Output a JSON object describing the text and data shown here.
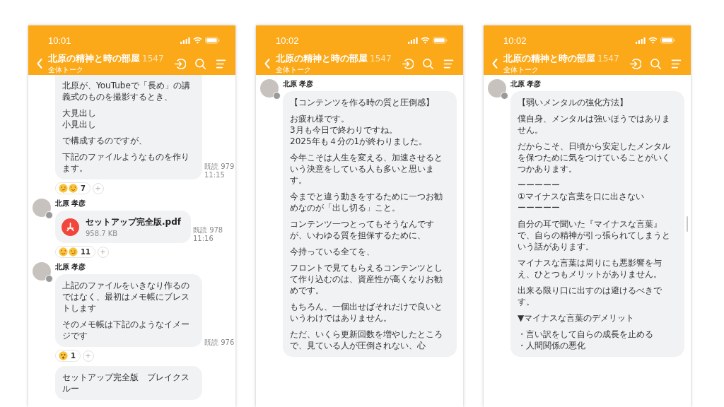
{
  "phones": [
    {
      "status_bar": {
        "time": "10:01"
      },
      "header": {
        "title": "北原の精神と時の部屋",
        "member_count": "1547",
        "subtitle": "全体トーク"
      },
      "messages": [
        {
          "kind": "text",
          "continued": true,
          "paragraphs": [
            [
              "北原が、YouTubeで「長め」の講義式のものを撮影するとき、"
            ],
            [
              "大見出し",
              "小見出し"
            ],
            [
              "で構成するのですが、"
            ],
            [
              "下記のファイルようなものを作ります。"
            ]
          ],
          "read": "既読 979",
          "time": "11:15",
          "reactions": {
            "emojis": [
              {
                "kind": "smirk"
              },
              {
                "kind": "heart_eyes"
              }
            ],
            "count": "7"
          }
        },
        {
          "kind": "file",
          "sender": {
            "name": "北原 孝彦"
          },
          "file_name": "セットアップ完全版.pdf",
          "file_size": "958.7 KB",
          "read": "既読 978",
          "time": "11:16",
          "reactions": {
            "emojis": [
              {
                "kind": "heart_eyes"
              },
              {
                "kind": "smirk"
              }
            ],
            "count": "11"
          }
        },
        {
          "kind": "text",
          "sender": {
            "name": "北原 孝彦"
          },
          "paragraphs": [
            [
              "上記のファイルをいきなり作るのではなく、最初はメモ帳にブレストします"
            ],
            [
              "そのメモ帳は下記のようなイメージです"
            ]
          ],
          "read": "既読 976",
          "reactions": {
            "emojis": [
              {
                "kind": "shocked"
              }
            ],
            "count": "1"
          }
        },
        {
          "kind": "text",
          "paragraphs": [
            [
              "セットアップ完全版　ブレイクスルー"
            ]
          ]
        }
      ]
    },
    {
      "status_bar": {
        "time": "10:02"
      },
      "header": {
        "title": "北原の精神と時の部屋",
        "member_count": "1547",
        "subtitle": "全体トーク"
      },
      "messages": [
        {
          "kind": "text",
          "sender": {
            "name": "北原 孝彦"
          },
          "paragraphs": [
            [
              "【コンテンツを作る時の質と圧倒感】"
            ],
            [
              "お疲れ様です。",
              "3月も今日で終わりですね。",
              "2025年も４分の1が終わりました。"
            ],
            [
              "今年こそは人生を変える、加速させるという決意をしている人も多いと思います。"
            ],
            [
              "今までと違う動きをするために一つお勧めなのが「出し切る」こと。"
            ],
            [
              "コンテンツ一つとってもそうなんですが、いわゆる質を担保するために、"
            ],
            [
              "今持っている全てを、"
            ],
            [
              "フロントで見てもらえるコンテンツとして作り込むのは、資産性が高くなりお勧めです。"
            ],
            [
              "もちろん、一個出せばそれだけで良いというわけではありません。"
            ],
            [
              "ただ、いくら更新回数を増やしたところで、見ている人が圧倒されない、心"
            ]
          ]
        }
      ]
    },
    {
      "status_bar": {
        "time": "10:02"
      },
      "header": {
        "title": "北原の精神と時の部屋",
        "member_count": "1547",
        "subtitle": "全体トーク"
      },
      "scrollbar": true,
      "messages": [
        {
          "kind": "text",
          "sender": {
            "name": "北原 孝彦"
          },
          "paragraphs": [
            [
              "【弱いメンタルの強化方法】"
            ],
            [
              "僕自身、メンタルは強いほうではありません。"
            ],
            [
              "だからこそ、日頃から安定したメンタルを保つために気をつけていることがいくつかあります。"
            ],
            [
              "ーーーーー",
              "①マイナスな言葉を口に出さない",
              "ーーーーー"
            ],
            [
              "自分の耳で聞いた『マイナスな言葉』で、自らの精神が引っ張られてしまうという話があります。"
            ],
            [
              "マイナスな言葉は周りにも悪影響を与え、ひとつもメリットがありません。"
            ],
            [
              "出来る限り口に出すのは避けるべきです。"
            ],
            [
              "▼マイナスな言葉のデメリット"
            ],
            [
              "・言い訳をして自らの成長を止める",
              "・人間関係の悪化"
            ]
          ]
        }
      ]
    }
  ]
}
